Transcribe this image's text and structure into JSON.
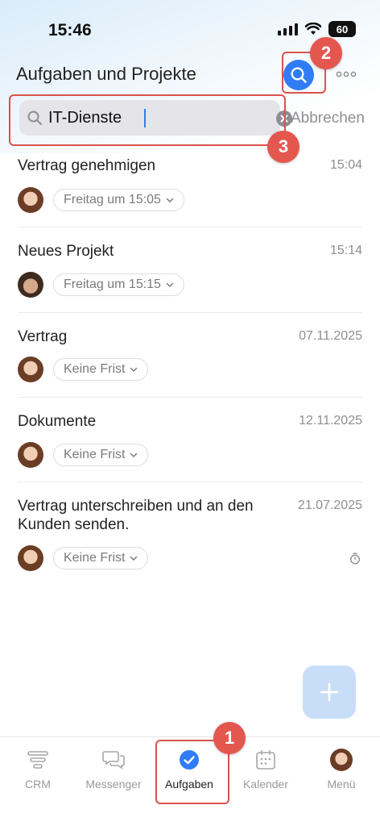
{
  "status_bar": {
    "time": "15:46",
    "battery": "60"
  },
  "header": {
    "title": "Aufgaben und Projekte"
  },
  "search": {
    "value": "IT-Dienste",
    "cancel_label": "Abbrechen"
  },
  "callouts": [
    "1",
    "2",
    "3"
  ],
  "tasks": [
    {
      "title": "Vertrag genehmigen",
      "time": "15:04",
      "deadline": "Freitag um 15:05",
      "avatar": "female"
    },
    {
      "title": "Neues Projekt",
      "time": "15:14",
      "deadline": "Freitag um 15:15",
      "avatar": "male"
    },
    {
      "title": "Vertrag",
      "time": "07.11.2025",
      "deadline": "Keine Frist",
      "avatar": "female"
    },
    {
      "title": "Dokumente",
      "time": "12.11.2025",
      "deadline": "Keine Frist",
      "avatar": "female"
    },
    {
      "title": "Vertrag unterschreiben und an den Kunden senden.",
      "time": "21.07.2025",
      "deadline": "Keine Frist",
      "avatar": "female",
      "has_timer": true
    }
  ],
  "fab": {
    "icon": "plus-icon"
  },
  "tab_bar": {
    "tabs": [
      {
        "label": "CRM",
        "icon": "crm-funnel-icon"
      },
      {
        "label": "Messenger",
        "icon": "chat-bubbles-icon"
      },
      {
        "label": "Aufgaben",
        "icon": "check-circle-icon",
        "active": true
      },
      {
        "label": "Kalender",
        "icon": "calendar-icon"
      },
      {
        "label": "Menü",
        "icon": "avatar-icon"
      }
    ]
  },
  "colors": {
    "accent": "#2f7cf6",
    "callout": "#e4574f",
    "muted": "#8e8e93"
  }
}
